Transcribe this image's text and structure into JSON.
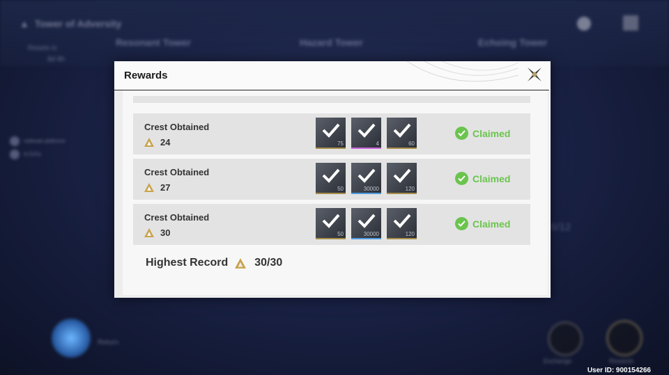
{
  "background": {
    "title": "Tower of Adversity",
    "tabs": [
      "Resonant Tower",
      "Hazard Tower",
      "Echoing Tower"
    ],
    "reset_line1": "Resets in",
    "reset_line2": "8d 8h",
    "side_players": [
      "nottimain plsBmme",
      "นิวไม่ไม่"
    ],
    "mid_text": "6/12",
    "return_label": "Return",
    "exchange_label": "Exchange",
    "rewards_label": "Rewards"
  },
  "user_id": "User ID: 900154266",
  "modal": {
    "title": "Rewards",
    "rows": [
      {
        "title": "Crest Obtained",
        "count": "24",
        "status": "Claimed",
        "items": [
          {
            "qty": "75",
            "rarity": "gold"
          },
          {
            "qty": "4",
            "rarity": "purple"
          },
          {
            "qty": "60",
            "rarity": "gold"
          }
        ]
      },
      {
        "title": "Crest Obtained",
        "count": "27",
        "status": "Claimed",
        "items": [
          {
            "qty": "50",
            "rarity": "gold"
          },
          {
            "qty": "30000",
            "rarity": "blue"
          },
          {
            "qty": "120",
            "rarity": "gold"
          }
        ]
      },
      {
        "title": "Crest Obtained",
        "count": "30",
        "status": "Claimed",
        "items": [
          {
            "qty": "50",
            "rarity": "gold"
          },
          {
            "qty": "30000",
            "rarity": "blue"
          },
          {
            "qty": "120",
            "rarity": "gold"
          }
        ]
      }
    ],
    "highest_label": "Highest Record",
    "highest_value": "30/30"
  },
  "colors": {
    "claimed_green": "#6bc44e",
    "crest_gold": "#c9a24a",
    "gold_border": "#a88d48",
    "purple_border": "#c864d8",
    "blue_border": "#4f9be0"
  }
}
